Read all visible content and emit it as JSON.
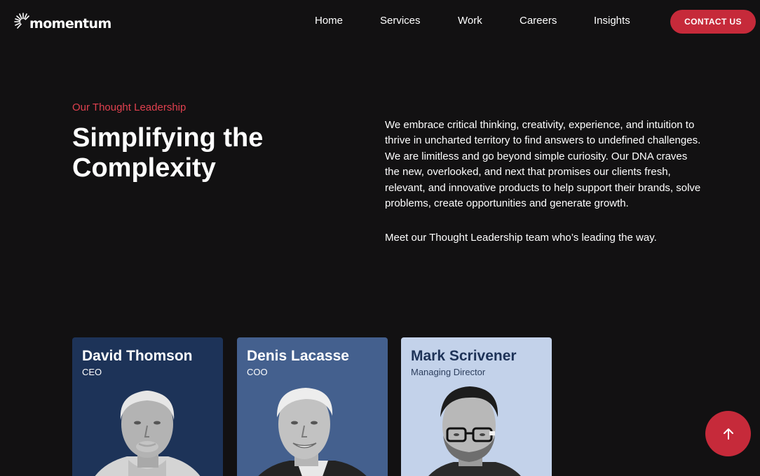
{
  "brand": {
    "name": "momentum"
  },
  "nav": {
    "items": [
      {
        "label": "Home"
      },
      {
        "label": "Services"
      },
      {
        "label": "Work"
      },
      {
        "label": "Careers"
      },
      {
        "label": "Insights"
      }
    ],
    "contact_label": "CONTACT US"
  },
  "hero": {
    "eyebrow": "Our Thought Leadership",
    "headline": "Simplifying the\nComplexity",
    "paragraphs": [
      "We embrace critical thinking, creativity, experience, and intuition to thrive in uncharted territory to find answers to undefined challenges. We are limitless and go beyond simple curiosity. Our DNA craves the new, overlooked, and next that promises our clients fresh, relevant, and innovative products to help support their brands, solve problems, create opportunities and generate growth.",
      "Meet our Thought Leadership team who’s leading the way."
    ]
  },
  "team": [
    {
      "name": "David Thomson",
      "role": "CEO",
      "card_color": "#1d3358",
      "text_color": "#ffffff",
      "role_color": "#ffffff"
    },
    {
      "name": "Denis Lacasse",
      "role": "COO",
      "card_color": "#44608e",
      "text_color": "#ffffff",
      "role_color": "#ffffff"
    },
    {
      "name": "Mark Scrivener",
      "role": "Managing Director",
      "card_color": "#c3d2ea",
      "text_color": "#1e3358",
      "role_color": "#2d3f5e"
    }
  ],
  "colors": {
    "accent": "#c62a3a",
    "eyebrow": "#e0414f",
    "background": "#121112"
  },
  "icons": {
    "scroll_top": "arrow-up-icon",
    "logo": "momentum-burst-logo"
  }
}
